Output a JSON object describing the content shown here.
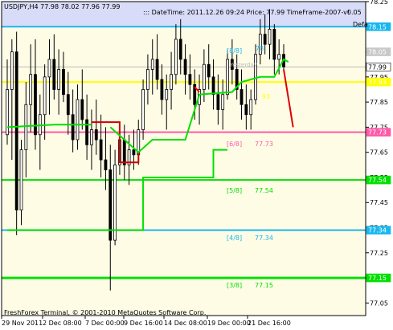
{
  "header": {
    "symbol_line": "USDJPY,H4  77.98 78.02 77.96 77.99",
    "info_line": "::: DateTime: 2011.12.26 09:24   Price: 77.99   TimeFrame-2007-v0.05",
    "corner_label": "Defa",
    "corner_mark": "!"
  },
  "footer": "FreshForex Terminal, © 2001-2010 MetaQuotes Software Corp.",
  "level_labels": [
    {
      "name": "[8/8]",
      "value": "78.15",
      "color": "#19b7f0"
    },
    {
      "name": "",
      "value": "",
      "color": "#ffff00"
    },
    {
      "name": "[6/8]",
      "value": "77.73",
      "color": "#ff5aa8"
    },
    {
      "name": "[5/8]",
      "value": "77.54",
      "color": "#00e000"
    },
    {
      "name": "[4/8]",
      "value": "77.34",
      "color": "#19b7f0"
    },
    {
      "name": "[3/8]",
      "value": "77.15",
      "color": "#00e000"
    }
  ],
  "annotations": {
    "yesterday": "Yesterday",
    "label_78": "78",
    "label_93": "93"
  },
  "chart_data": {
    "type": "candlestick",
    "title": "USDJPY,H4",
    "ylim": [
      77.0,
      78.25
    ],
    "y_ticks": [
      "78.25",
      "78.15",
      "78.05",
      "77.95",
      "77.85",
      "77.75",
      "77.65",
      "77.55",
      "77.45",
      "77.35",
      "77.25",
      "77.15",
      "77.05"
    ],
    "x_ticks": [
      "29 Nov 2011",
      "2 Dec 08:00",
      "7 Dec 00:00",
      "9 Dec 16:00",
      "14 Dec 08:00",
      "19 Dec 00:00",
      "21 Dec 16:00"
    ],
    "price_tags": [
      {
        "value": 78.15,
        "text": "78.15",
        "bg": "#19b7f0",
        "fg": "#ffffff"
      },
      {
        "value": 78.05,
        "text": "78.05",
        "bg": "#c8c8c8",
        "fg": "#ffffff"
      },
      {
        "value": 77.99,
        "text": "77.99",
        "bg": "#ffffff",
        "fg": "#000000"
      },
      {
        "value": 77.93,
        "text": "77.93",
        "bg": "#ffff00",
        "fg": "#ffffff"
      },
      {
        "value": 77.73,
        "text": "77.73",
        "bg": "#ff5aa8",
        "fg": "#ffffff"
      },
      {
        "value": 77.54,
        "text": "77.54",
        "bg": "#00e000",
        "fg": "#ffffff"
      },
      {
        "value": 77.34,
        "text": "77.34",
        "bg": "#19b7f0",
        "fg": "#ffffff"
      },
      {
        "value": 77.15,
        "text": "77.15",
        "bg": "#00e000",
        "fg": "#ffffff"
      }
    ],
    "levels": [
      {
        "value": 78.15,
        "color": "#19b7f0",
        "width": 2
      },
      {
        "value": 77.93,
        "color": "#ffff00",
        "width": 2
      },
      {
        "value": 77.73,
        "color": "#ff5aa8",
        "width": 2
      },
      {
        "value": 77.54,
        "color": "#00e000",
        "width": 2
      },
      {
        "value": 77.34,
        "color": "#19b7f0",
        "width": 2
      },
      {
        "value": 77.15,
        "color": "#00e000",
        "width": 3
      }
    ],
    "grey_levels": [
      77.99
    ],
    "bands": [
      {
        "from": 78.25,
        "to": 78.15,
        "color": "#d8dcf8"
      },
      {
        "from": 78.15,
        "to": 77.0,
        "color": "#fffce6"
      }
    ],
    "candles": [
      [
        77.72,
        78.02,
        77.68,
        77.9
      ],
      [
        77.9,
        78.1,
        77.62,
        78.05
      ],
      [
        78.05,
        78.13,
        77.32,
        77.42
      ],
      [
        77.42,
        77.7,
        77.36,
        77.66
      ],
      [
        77.66,
        77.93,
        77.55,
        77.84
      ],
      [
        77.84,
        78.08,
        77.73,
        77.96
      ],
      [
        77.96,
        78.1,
        77.66,
        77.72
      ],
      [
        77.72,
        77.88,
        77.58,
        77.8
      ],
      [
        77.8,
        78.0,
        77.7,
        77.95
      ],
      [
        77.95,
        78.1,
        77.8,
        78.02
      ],
      [
        78.02,
        78.12,
        77.86,
        77.9
      ],
      [
        77.9,
        78.06,
        77.8,
        77.98
      ],
      [
        77.98,
        78.05,
        77.85,
        77.88
      ],
      [
        77.88,
        77.97,
        77.72,
        77.8
      ],
      [
        77.8,
        77.9,
        77.65,
        77.7
      ],
      [
        77.7,
        77.92,
        77.66,
        77.86
      ],
      [
        77.86,
        77.98,
        77.74,
        77.78
      ],
      [
        77.78,
        77.88,
        77.62,
        77.68
      ],
      [
        77.68,
        77.82,
        77.58,
        77.74
      ],
      [
        77.74,
        77.86,
        77.64,
        77.7
      ],
      [
        77.7,
        77.8,
        77.55,
        77.62
      ],
      [
        77.62,
        77.75,
        77.5,
        77.58
      ],
      [
        77.58,
        77.68,
        77.1,
        77.3
      ],
      [
        77.3,
        77.66,
        77.28,
        77.6
      ],
      [
        77.6,
        77.74,
        77.56,
        77.7
      ],
      [
        77.7,
        77.76,
        77.54,
        77.6
      ],
      [
        77.6,
        77.72,
        77.52,
        77.66
      ],
      [
        77.66,
        77.74,
        77.58,
        77.64
      ],
      [
        77.64,
        77.78,
        77.6,
        77.74
      ],
      [
        77.74,
        77.94,
        77.7,
        77.9
      ],
      [
        77.9,
        78.04,
        77.84,
        77.98
      ],
      [
        77.98,
        78.1,
        77.88,
        78.02
      ],
      [
        78.02,
        78.12,
        77.9,
        77.94
      ],
      [
        77.94,
        78.0,
        77.8,
        77.86
      ],
      [
        77.86,
        77.96,
        77.74,
        77.9
      ],
      [
        77.9,
        78.05,
        77.82,
        77.96
      ],
      [
        77.96,
        78.16,
        77.92,
        78.1
      ],
      [
        78.1,
        78.18,
        77.96,
        78.02
      ],
      [
        78.02,
        78.08,
        77.88,
        77.96
      ],
      [
        77.96,
        78.04,
        77.86,
        77.92
      ],
      [
        77.92,
        77.98,
        77.78,
        77.84
      ],
      [
        77.84,
        77.96,
        77.76,
        77.9
      ],
      [
        77.9,
        78.06,
        77.85,
        78.0
      ],
      [
        78.0,
        78.08,
        77.9,
        77.95
      ],
      [
        77.95,
        78.02,
        77.82,
        77.88
      ],
      [
        77.88,
        77.96,
        77.76,
        77.82
      ],
      [
        77.82,
        77.94,
        77.74,
        77.88
      ],
      [
        77.88,
        78.06,
        77.86,
        78.02
      ],
      [
        78.02,
        78.1,
        77.92,
        77.98
      ],
      [
        77.98,
        78.04,
        77.86,
        77.9
      ],
      [
        77.9,
        77.98,
        77.78,
        77.84
      ],
      [
        77.84,
        77.92,
        77.74,
        77.8
      ],
      [
        77.8,
        77.9,
        77.74,
        77.86
      ],
      [
        77.86,
        78.08,
        77.84,
        78.04
      ],
      [
        78.04,
        78.18,
        78.0,
        78.12
      ],
      [
        78.12,
        78.2,
        78.04,
        78.08
      ],
      [
        78.08,
        78.22,
        78.02,
        78.14
      ],
      [
        78.14,
        78.16,
        77.96,
        78.02
      ],
      [
        78.02,
        78.1,
        77.96,
        78.04
      ],
      [
        78.04,
        78.08,
        77.97,
        77.99
      ]
    ],
    "indicator_segments": [
      {
        "color": "#00e000",
        "points": [
          [
            0,
            77.34
          ],
          [
            29,
            77.34
          ],
          [
            29,
            77.55
          ],
          [
            44,
            77.55
          ],
          [
            44,
            77.66
          ],
          [
            47,
            77.66
          ]
        ]
      },
      {
        "color": "#00e000",
        "points": [
          [
            0,
            77.75
          ],
          [
            10,
            77.76
          ],
          [
            18,
            77.76
          ]
        ]
      },
      {
        "color": "#cc0000",
        "points": [
          [
            18,
            77.77
          ],
          [
            24,
            77.77
          ],
          [
            24,
            77.61
          ],
          [
            28,
            77.61
          ],
          [
            28,
            77.65
          ]
        ]
      },
      {
        "color": "#00e000",
        "points": [
          [
            22,
            77.75
          ],
          [
            28,
            77.65
          ],
          [
            31,
            77.7
          ],
          [
            38,
            77.7
          ],
          [
            41,
            77.88
          ],
          [
            48,
            77.89
          ],
          [
            50,
            77.93
          ],
          [
            54,
            77.95
          ],
          [
            57,
            77.95
          ],
          [
            59,
            78.02
          ],
          [
            60,
            78.01
          ]
        ]
      },
      {
        "color": "#dd0000",
        "points": [
          [
            59,
            77.98
          ],
          [
            61,
            77.75
          ]
        ]
      },
      {
        "color": "#ff0000",
        "points": [
          [
            40,
            77.91
          ],
          [
            41,
            77.89
          ]
        ]
      }
    ]
  }
}
